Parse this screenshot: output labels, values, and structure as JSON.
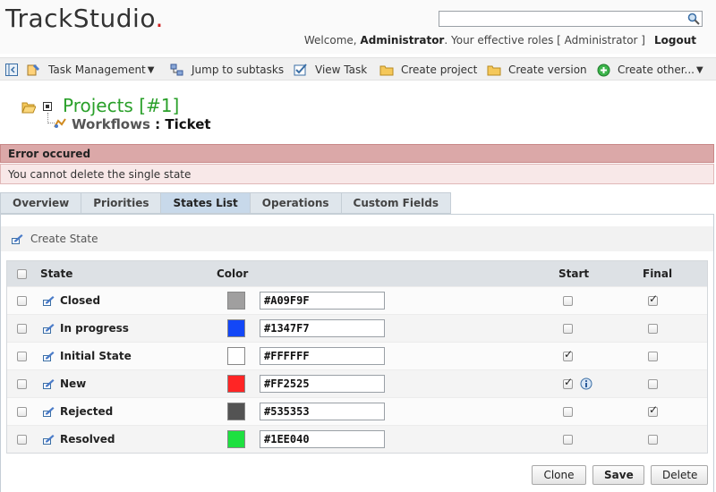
{
  "header": {
    "logo_text": "TrackStudio",
    "logo_dot": ".",
    "search": {
      "value": ""
    },
    "welcome_prefix": "Welcome, ",
    "user": "Administrator",
    "roles_text": ". Your effective roles  [ Administrator ]",
    "logout": "Logout"
  },
  "toolbar": {
    "items": [
      {
        "label": "Task Management",
        "icon": "task-management-icon",
        "dropdown": true
      },
      {
        "label": "Jump to subtasks",
        "icon": "jump-subtasks-icon"
      },
      {
        "label": "View Task",
        "icon": "view-task-icon"
      },
      {
        "label": "Create project",
        "icon": "folder-icon"
      },
      {
        "label": "Create version",
        "icon": "folder-icon"
      },
      {
        "label": "Create other...",
        "icon": "plus-circle-icon",
        "dropdown": true
      }
    ]
  },
  "breadcrumb": {
    "title": "Projects  [#1]",
    "sub_label": "Workflows",
    "separator": " : ",
    "ticket": "Ticket"
  },
  "error": {
    "title": "Error occured",
    "message": "You cannot delete the single state"
  },
  "tabs": [
    {
      "label": "Overview",
      "active": false
    },
    {
      "label": "Priorities",
      "active": false
    },
    {
      "label": "States List",
      "active": true
    },
    {
      "label": "Operations",
      "active": false
    },
    {
      "label": "Custom Fields",
      "active": false
    }
  ],
  "create_state_label": "Create State",
  "table": {
    "headers": {
      "state": "State",
      "color": "Color",
      "start": "Start",
      "final": "Final"
    },
    "rows": [
      {
        "name": "Closed",
        "color": "#A09F9F",
        "start": false,
        "final": true,
        "info": false
      },
      {
        "name": "In progress",
        "color": "#1347F7",
        "start": false,
        "final": false,
        "info": false
      },
      {
        "name": "Initial State",
        "color": "#FFFFFF",
        "start": true,
        "final": false,
        "info": false
      },
      {
        "name": "New",
        "color": "#FF2525",
        "start": true,
        "final": false,
        "info": true
      },
      {
        "name": "Rejected",
        "color": "#535353",
        "start": false,
        "final": true,
        "info": false
      },
      {
        "name": "Resolved",
        "color": "#1EE040",
        "start": false,
        "final": false,
        "info": false
      }
    ]
  },
  "buttons": {
    "clone": "Clone",
    "save": "Save",
    "delete": "Delete"
  },
  "colors": {
    "title_green": "#2aa02a",
    "error_head_bg": "#dba8a8",
    "error_body_bg": "#f8e8e8",
    "active_tab_bg": "#c8d9ea"
  }
}
